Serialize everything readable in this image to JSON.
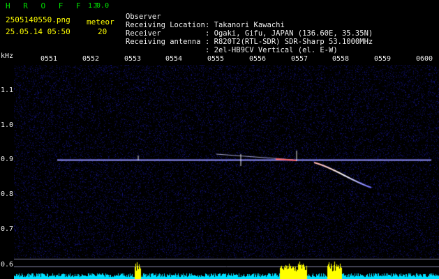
{
  "header": {
    "brand": "H R O F F T",
    "version": "1.0.0",
    "file_name": "2505140550.png",
    "datetime": "25.05.14 05:50",
    "meteor_label": "meteor",
    "meteor_count": "20"
  },
  "info": [
    {
      "key": "Observer",
      "value": ": Takanori Kawachi"
    },
    {
      "key": "Receiving Location",
      "value": ": Ogaki, Gifu, JAPAN (136.60E, 35.35N)"
    },
    {
      "key": "Receiver",
      "value": ": R820T2(RTL-SDR) SDR-Sharp 53.1000MHz"
    },
    {
      "key": "Receiving antenna",
      "value": ": 2el-HB9CV Vertical (el. E-W)"
    }
  ],
  "axes": {
    "y_unit": "kHz",
    "x_ticks": [
      "0551",
      "0552",
      "0553",
      "0554",
      "0555",
      "0556",
      "0557",
      "0558",
      "0559",
      "0600"
    ],
    "y_ticks": [
      "1.1",
      "1.0",
      "0.9",
      "0.8",
      "0.7",
      "0.6"
    ]
  },
  "colors": {
    "background": "#000000",
    "noise": "#0a0a5a",
    "carrier": "#d8d8ff",
    "bars": "#00e0ff",
    "bar_peaks": "#ffff00"
  }
}
